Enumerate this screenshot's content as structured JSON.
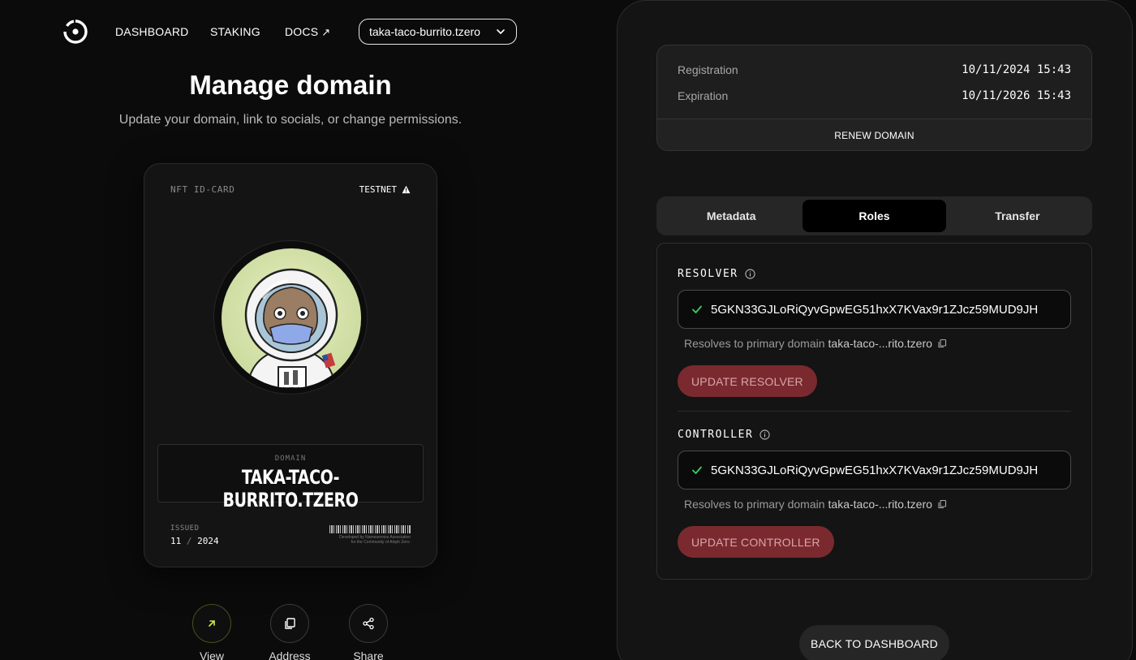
{
  "nav": {
    "items": [
      {
        "label": "DASHBOARD"
      },
      {
        "label": "STAKING"
      },
      {
        "label": "DOCS",
        "external_icon": "arrow-up-right-icon"
      }
    ],
    "domain_select": "taka-taco-burrito.tzero"
  },
  "header": {
    "title": "Manage domain",
    "subtitle": "Update your domain, link to socials, or change permissions."
  },
  "card": {
    "kicker": "NFT ID-CARD",
    "network": "TESTNET",
    "domain_label": "DOMAIN",
    "domain_name": "TAKA-TACO-BURRITO.TZERO",
    "issued_label": "ISSUED",
    "issued_month": "11",
    "issued_sep": "/",
    "issued_year": "2024",
    "dev_note_1": "Developed by Nameservice Association",
    "dev_note_2": "for the Community of Aleph Zero."
  },
  "actions": [
    {
      "label": "View",
      "icon": "arrow-up-right-icon"
    },
    {
      "label": "Address",
      "icon": "copy-icon"
    },
    {
      "label": "Share",
      "icon": "share-icon"
    }
  ],
  "registration": {
    "registration_label": "Registration",
    "registration_value": "10/11/2024 15:43",
    "expiration_label": "Expiration",
    "expiration_value": "10/11/2026 15:43",
    "renew_label": "RENEW DOMAIN"
  },
  "tabs": {
    "metadata": "Metadata",
    "roles": "Roles",
    "transfer": "Transfer",
    "active": "Roles"
  },
  "roles": {
    "resolver": {
      "title": "RESOLVER",
      "address": "5GKN33GJLoRiQyvGpwEG51hxX7KVax9r1ZJcz59MUD9JH",
      "note_prefix": "Resolves to primary domain",
      "note_domain": "taka-taco-...rito.tzero",
      "button": "UPDATE RESOLVER"
    },
    "controller": {
      "title": "CONTROLLER",
      "address": "5GKN33GJLoRiQyvGpwEG51hxX7KVax9r1ZJcz59MUD9JH",
      "note_prefix": "Resolves to primary domain",
      "note_domain": "taka-taco-...rito.tzero",
      "button": "UPDATE CONTROLLER"
    }
  },
  "back_button": "BACK TO DASHBOARD",
  "colors": {
    "background": "#0b0b0b",
    "panel": "#141414",
    "update_button": "#7a2a2f",
    "check_green": "#3ccf6a",
    "view_accent": "#d6e94a"
  }
}
